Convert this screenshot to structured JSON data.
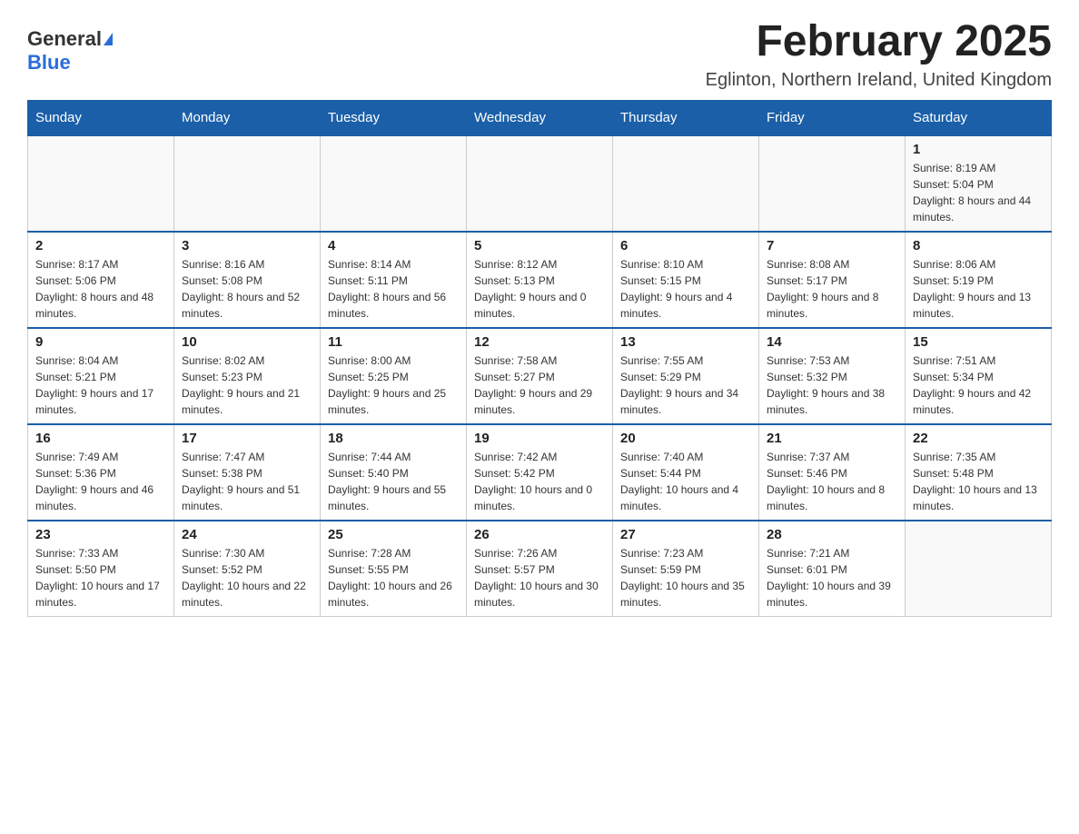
{
  "header": {
    "logo_general": "General",
    "logo_blue": "Blue",
    "month_title": "February 2025",
    "location": "Eglinton, Northern Ireland, United Kingdom"
  },
  "days_of_week": [
    "Sunday",
    "Monday",
    "Tuesday",
    "Wednesday",
    "Thursday",
    "Friday",
    "Saturday"
  ],
  "weeks": [
    [
      {
        "day": "",
        "sunrise": "",
        "sunset": "",
        "daylight": ""
      },
      {
        "day": "",
        "sunrise": "",
        "sunset": "",
        "daylight": ""
      },
      {
        "day": "",
        "sunrise": "",
        "sunset": "",
        "daylight": ""
      },
      {
        "day": "",
        "sunrise": "",
        "sunset": "",
        "daylight": ""
      },
      {
        "day": "",
        "sunrise": "",
        "sunset": "",
        "daylight": ""
      },
      {
        "day": "",
        "sunrise": "",
        "sunset": "",
        "daylight": ""
      },
      {
        "day": "1",
        "sunrise": "Sunrise: 8:19 AM",
        "sunset": "Sunset: 5:04 PM",
        "daylight": "Daylight: 8 hours and 44 minutes."
      }
    ],
    [
      {
        "day": "2",
        "sunrise": "Sunrise: 8:17 AM",
        "sunset": "Sunset: 5:06 PM",
        "daylight": "Daylight: 8 hours and 48 minutes."
      },
      {
        "day": "3",
        "sunrise": "Sunrise: 8:16 AM",
        "sunset": "Sunset: 5:08 PM",
        "daylight": "Daylight: 8 hours and 52 minutes."
      },
      {
        "day": "4",
        "sunrise": "Sunrise: 8:14 AM",
        "sunset": "Sunset: 5:11 PM",
        "daylight": "Daylight: 8 hours and 56 minutes."
      },
      {
        "day": "5",
        "sunrise": "Sunrise: 8:12 AM",
        "sunset": "Sunset: 5:13 PM",
        "daylight": "Daylight: 9 hours and 0 minutes."
      },
      {
        "day": "6",
        "sunrise": "Sunrise: 8:10 AM",
        "sunset": "Sunset: 5:15 PM",
        "daylight": "Daylight: 9 hours and 4 minutes."
      },
      {
        "day": "7",
        "sunrise": "Sunrise: 8:08 AM",
        "sunset": "Sunset: 5:17 PM",
        "daylight": "Daylight: 9 hours and 8 minutes."
      },
      {
        "day": "8",
        "sunrise": "Sunrise: 8:06 AM",
        "sunset": "Sunset: 5:19 PM",
        "daylight": "Daylight: 9 hours and 13 minutes."
      }
    ],
    [
      {
        "day": "9",
        "sunrise": "Sunrise: 8:04 AM",
        "sunset": "Sunset: 5:21 PM",
        "daylight": "Daylight: 9 hours and 17 minutes."
      },
      {
        "day": "10",
        "sunrise": "Sunrise: 8:02 AM",
        "sunset": "Sunset: 5:23 PM",
        "daylight": "Daylight: 9 hours and 21 minutes."
      },
      {
        "day": "11",
        "sunrise": "Sunrise: 8:00 AM",
        "sunset": "Sunset: 5:25 PM",
        "daylight": "Daylight: 9 hours and 25 minutes."
      },
      {
        "day": "12",
        "sunrise": "Sunrise: 7:58 AM",
        "sunset": "Sunset: 5:27 PM",
        "daylight": "Daylight: 9 hours and 29 minutes."
      },
      {
        "day": "13",
        "sunrise": "Sunrise: 7:55 AM",
        "sunset": "Sunset: 5:29 PM",
        "daylight": "Daylight: 9 hours and 34 minutes."
      },
      {
        "day": "14",
        "sunrise": "Sunrise: 7:53 AM",
        "sunset": "Sunset: 5:32 PM",
        "daylight": "Daylight: 9 hours and 38 minutes."
      },
      {
        "day": "15",
        "sunrise": "Sunrise: 7:51 AM",
        "sunset": "Sunset: 5:34 PM",
        "daylight": "Daylight: 9 hours and 42 minutes."
      }
    ],
    [
      {
        "day": "16",
        "sunrise": "Sunrise: 7:49 AM",
        "sunset": "Sunset: 5:36 PM",
        "daylight": "Daylight: 9 hours and 46 minutes."
      },
      {
        "day": "17",
        "sunrise": "Sunrise: 7:47 AM",
        "sunset": "Sunset: 5:38 PM",
        "daylight": "Daylight: 9 hours and 51 minutes."
      },
      {
        "day": "18",
        "sunrise": "Sunrise: 7:44 AM",
        "sunset": "Sunset: 5:40 PM",
        "daylight": "Daylight: 9 hours and 55 minutes."
      },
      {
        "day": "19",
        "sunrise": "Sunrise: 7:42 AM",
        "sunset": "Sunset: 5:42 PM",
        "daylight": "Daylight: 10 hours and 0 minutes."
      },
      {
        "day": "20",
        "sunrise": "Sunrise: 7:40 AM",
        "sunset": "Sunset: 5:44 PM",
        "daylight": "Daylight: 10 hours and 4 minutes."
      },
      {
        "day": "21",
        "sunrise": "Sunrise: 7:37 AM",
        "sunset": "Sunset: 5:46 PM",
        "daylight": "Daylight: 10 hours and 8 minutes."
      },
      {
        "day": "22",
        "sunrise": "Sunrise: 7:35 AM",
        "sunset": "Sunset: 5:48 PM",
        "daylight": "Daylight: 10 hours and 13 minutes."
      }
    ],
    [
      {
        "day": "23",
        "sunrise": "Sunrise: 7:33 AM",
        "sunset": "Sunset: 5:50 PM",
        "daylight": "Daylight: 10 hours and 17 minutes."
      },
      {
        "day": "24",
        "sunrise": "Sunrise: 7:30 AM",
        "sunset": "Sunset: 5:52 PM",
        "daylight": "Daylight: 10 hours and 22 minutes."
      },
      {
        "day": "25",
        "sunrise": "Sunrise: 7:28 AM",
        "sunset": "Sunset: 5:55 PM",
        "daylight": "Daylight: 10 hours and 26 minutes."
      },
      {
        "day": "26",
        "sunrise": "Sunrise: 7:26 AM",
        "sunset": "Sunset: 5:57 PM",
        "daylight": "Daylight: 10 hours and 30 minutes."
      },
      {
        "day": "27",
        "sunrise": "Sunrise: 7:23 AM",
        "sunset": "Sunset: 5:59 PM",
        "daylight": "Daylight: 10 hours and 35 minutes."
      },
      {
        "day": "28",
        "sunrise": "Sunrise: 7:21 AM",
        "sunset": "Sunset: 6:01 PM",
        "daylight": "Daylight: 10 hours and 39 minutes."
      },
      {
        "day": "",
        "sunrise": "",
        "sunset": "",
        "daylight": ""
      }
    ]
  ]
}
